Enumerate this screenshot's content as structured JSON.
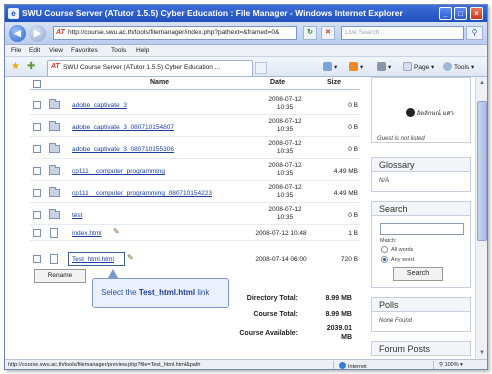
{
  "window": {
    "title": "SWU Course Server (ATutor 1.5.5) Cyber Education : File Manager - Windows Internet Explorer",
    "app_icon": "ie-icon"
  },
  "address_bar": {
    "url": "http://course.swu.ac.th/tools/filemanager/index.php?pathext=&framed=0&",
    "search_placeholder": "Live Search"
  },
  "menu": {
    "items": [
      "File",
      "Edit",
      "View",
      "Favorites",
      "Tools",
      "Help"
    ]
  },
  "tab": {
    "label": "SWU Course Server (ATutor 1.5.5) Cyber Education ...",
    "page_label": "Page",
    "tools_label": "Tools"
  },
  "file_table": {
    "headers": {
      "name": "Name",
      "date": "Date",
      "size": "Size"
    },
    "rows": [
      {
        "type": "folder",
        "name": "adobe_captivate_3",
        "date": "2008-07-12",
        "time": "10:35",
        "size": "0 B"
      },
      {
        "type": "folder",
        "name": "adobe_captivate_3_080710154807",
        "date": "2008-07-12",
        "time": "10:35",
        "size": "0 B"
      },
      {
        "type": "folder",
        "name": "adobe_captivate_3_080710155306",
        "date": "2008-07-12",
        "time": "10:35",
        "size": "0 B"
      },
      {
        "type": "folder",
        "name": "cp111__computer_programming",
        "date": "2008-07-12",
        "time": "10:35",
        "size": "4.49 MB"
      },
      {
        "type": "folder",
        "name": "cp111__computer_programming_080710154223",
        "date": "2008-07-12",
        "time": "10:35",
        "size": "4.49 MB"
      },
      {
        "type": "folder",
        "name": "test",
        "date": "2008-07-12",
        "time": "10:35",
        "size": "0 B"
      },
      {
        "type": "file",
        "name": "index.html",
        "datetime": "2008-07-12 10:48",
        "size": "1 B"
      },
      {
        "type": "file",
        "name": "Test_html.html",
        "datetime": "2008-07-14 06:00",
        "size": "720 B"
      }
    ],
    "rename_label": "Rename",
    "callout": {
      "prefix": "Select the ",
      "target": "Test_html.html",
      "suffix": " link"
    },
    "totals": {
      "directory_label": "Directory Total:",
      "directory_value": "8.99 MB",
      "course_label": "Course Total:",
      "course_value": "8.99 MB",
      "available_label": "Course Available:",
      "available_value": "2039.01",
      "available_unit": "MB"
    }
  },
  "sidebar": {
    "user_label": "Guest is not listed",
    "user_badge": "อัตลักษณ์ มศว",
    "glossary_title": "Glossary",
    "glossary_value": "N/A",
    "search_title": "Search",
    "match_label": "Match:",
    "all_words": "All words",
    "any_word": "Any word",
    "search_button": "Search",
    "polls_title": "Polls",
    "polls_value": "None Found",
    "forum_title": "Forum Posts"
  },
  "status_bar": {
    "url": "http://course.swu.ac.th/tools/filemanager/preview.php?file=Test_html.html&path",
    "zone": "Internet",
    "zoom": "100%"
  }
}
